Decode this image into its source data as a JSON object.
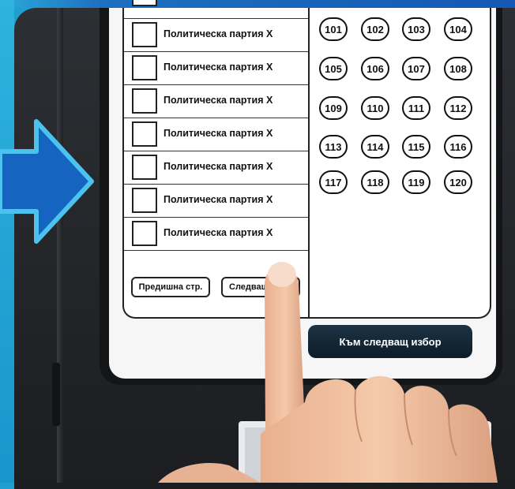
{
  "ballot": {
    "parties": [
      "Политическа партия X",
      "Политическа партия X",
      "Политическа партия X",
      "Политическа партия X",
      "Политическа партия X",
      "Политическа партия X",
      "Политическа партия X"
    ],
    "candidate_numbers": [
      "101",
      "102",
      "103",
      "104",
      "105",
      "106",
      "107",
      "108",
      "109",
      "110",
      "111",
      "112",
      "113",
      "114",
      "115",
      "116",
      "117",
      "118",
      "119",
      "120"
    ],
    "prev_page_label": "Предишна стр.",
    "next_page_label": "Следващ"
  },
  "next_choice_label": "Към следващ избор",
  "colors": {
    "frame_blue": "#1f9fd0",
    "arrow_blue": "#1565c0",
    "device_dark": "#24262a",
    "button_dark": "#0e1c28"
  },
  "icons": {
    "arrow": "arrow-right-icon",
    "hand": "pointing-hand-icon"
  }
}
